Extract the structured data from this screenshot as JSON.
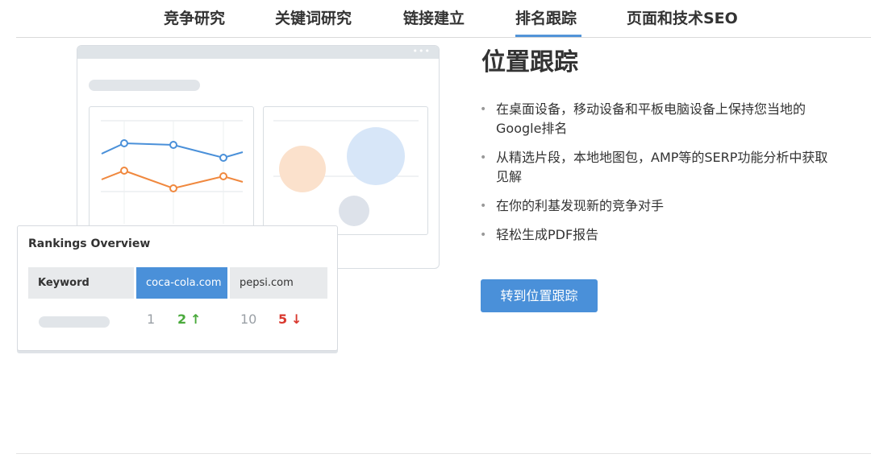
{
  "tabs": [
    {
      "label": "竞争研究",
      "active": false
    },
    {
      "label": "关键词研究",
      "active": false
    },
    {
      "label": "链接建立",
      "active": false
    },
    {
      "label": "排名跟踪",
      "active": true
    },
    {
      "label": "页面和技术SEO",
      "active": false
    }
  ],
  "illustration": {
    "dots": "•••",
    "line_colors": {
      "blue": "#4a90d9",
      "orange": "#f0883e"
    },
    "bubble_colors": {
      "blue": "#d7e6f8",
      "orange": "#fbe1cc",
      "grey": "#dde2ea"
    }
  },
  "rankings_card": {
    "title": "Rankings Overview",
    "headers": [
      "Keyword",
      "coca-cola.com",
      "pepsi.com"
    ],
    "row": {
      "coca_prev": "1",
      "coca_curr": "2",
      "coca_arrow": "↑",
      "pepsi_prev": "10",
      "pepsi_curr": "5",
      "pepsi_arrow": "↓"
    }
  },
  "main": {
    "heading": "位置跟踪",
    "bullets": [
      "在桌面设备，移动设备和平板电脑设备上保持您当地的Google排名",
      "从精选片段，本地地图包，AMP等的SERP功能分析中获取见解",
      "在你的利基发现新的竞争对手",
      "轻松生成PDF报告"
    ],
    "bullet_glyph": "•",
    "cta_label": "转到位置跟踪"
  },
  "colors": {
    "accent": "#4a90d9",
    "green": "#4aaa3c",
    "red": "#d9392f"
  }
}
